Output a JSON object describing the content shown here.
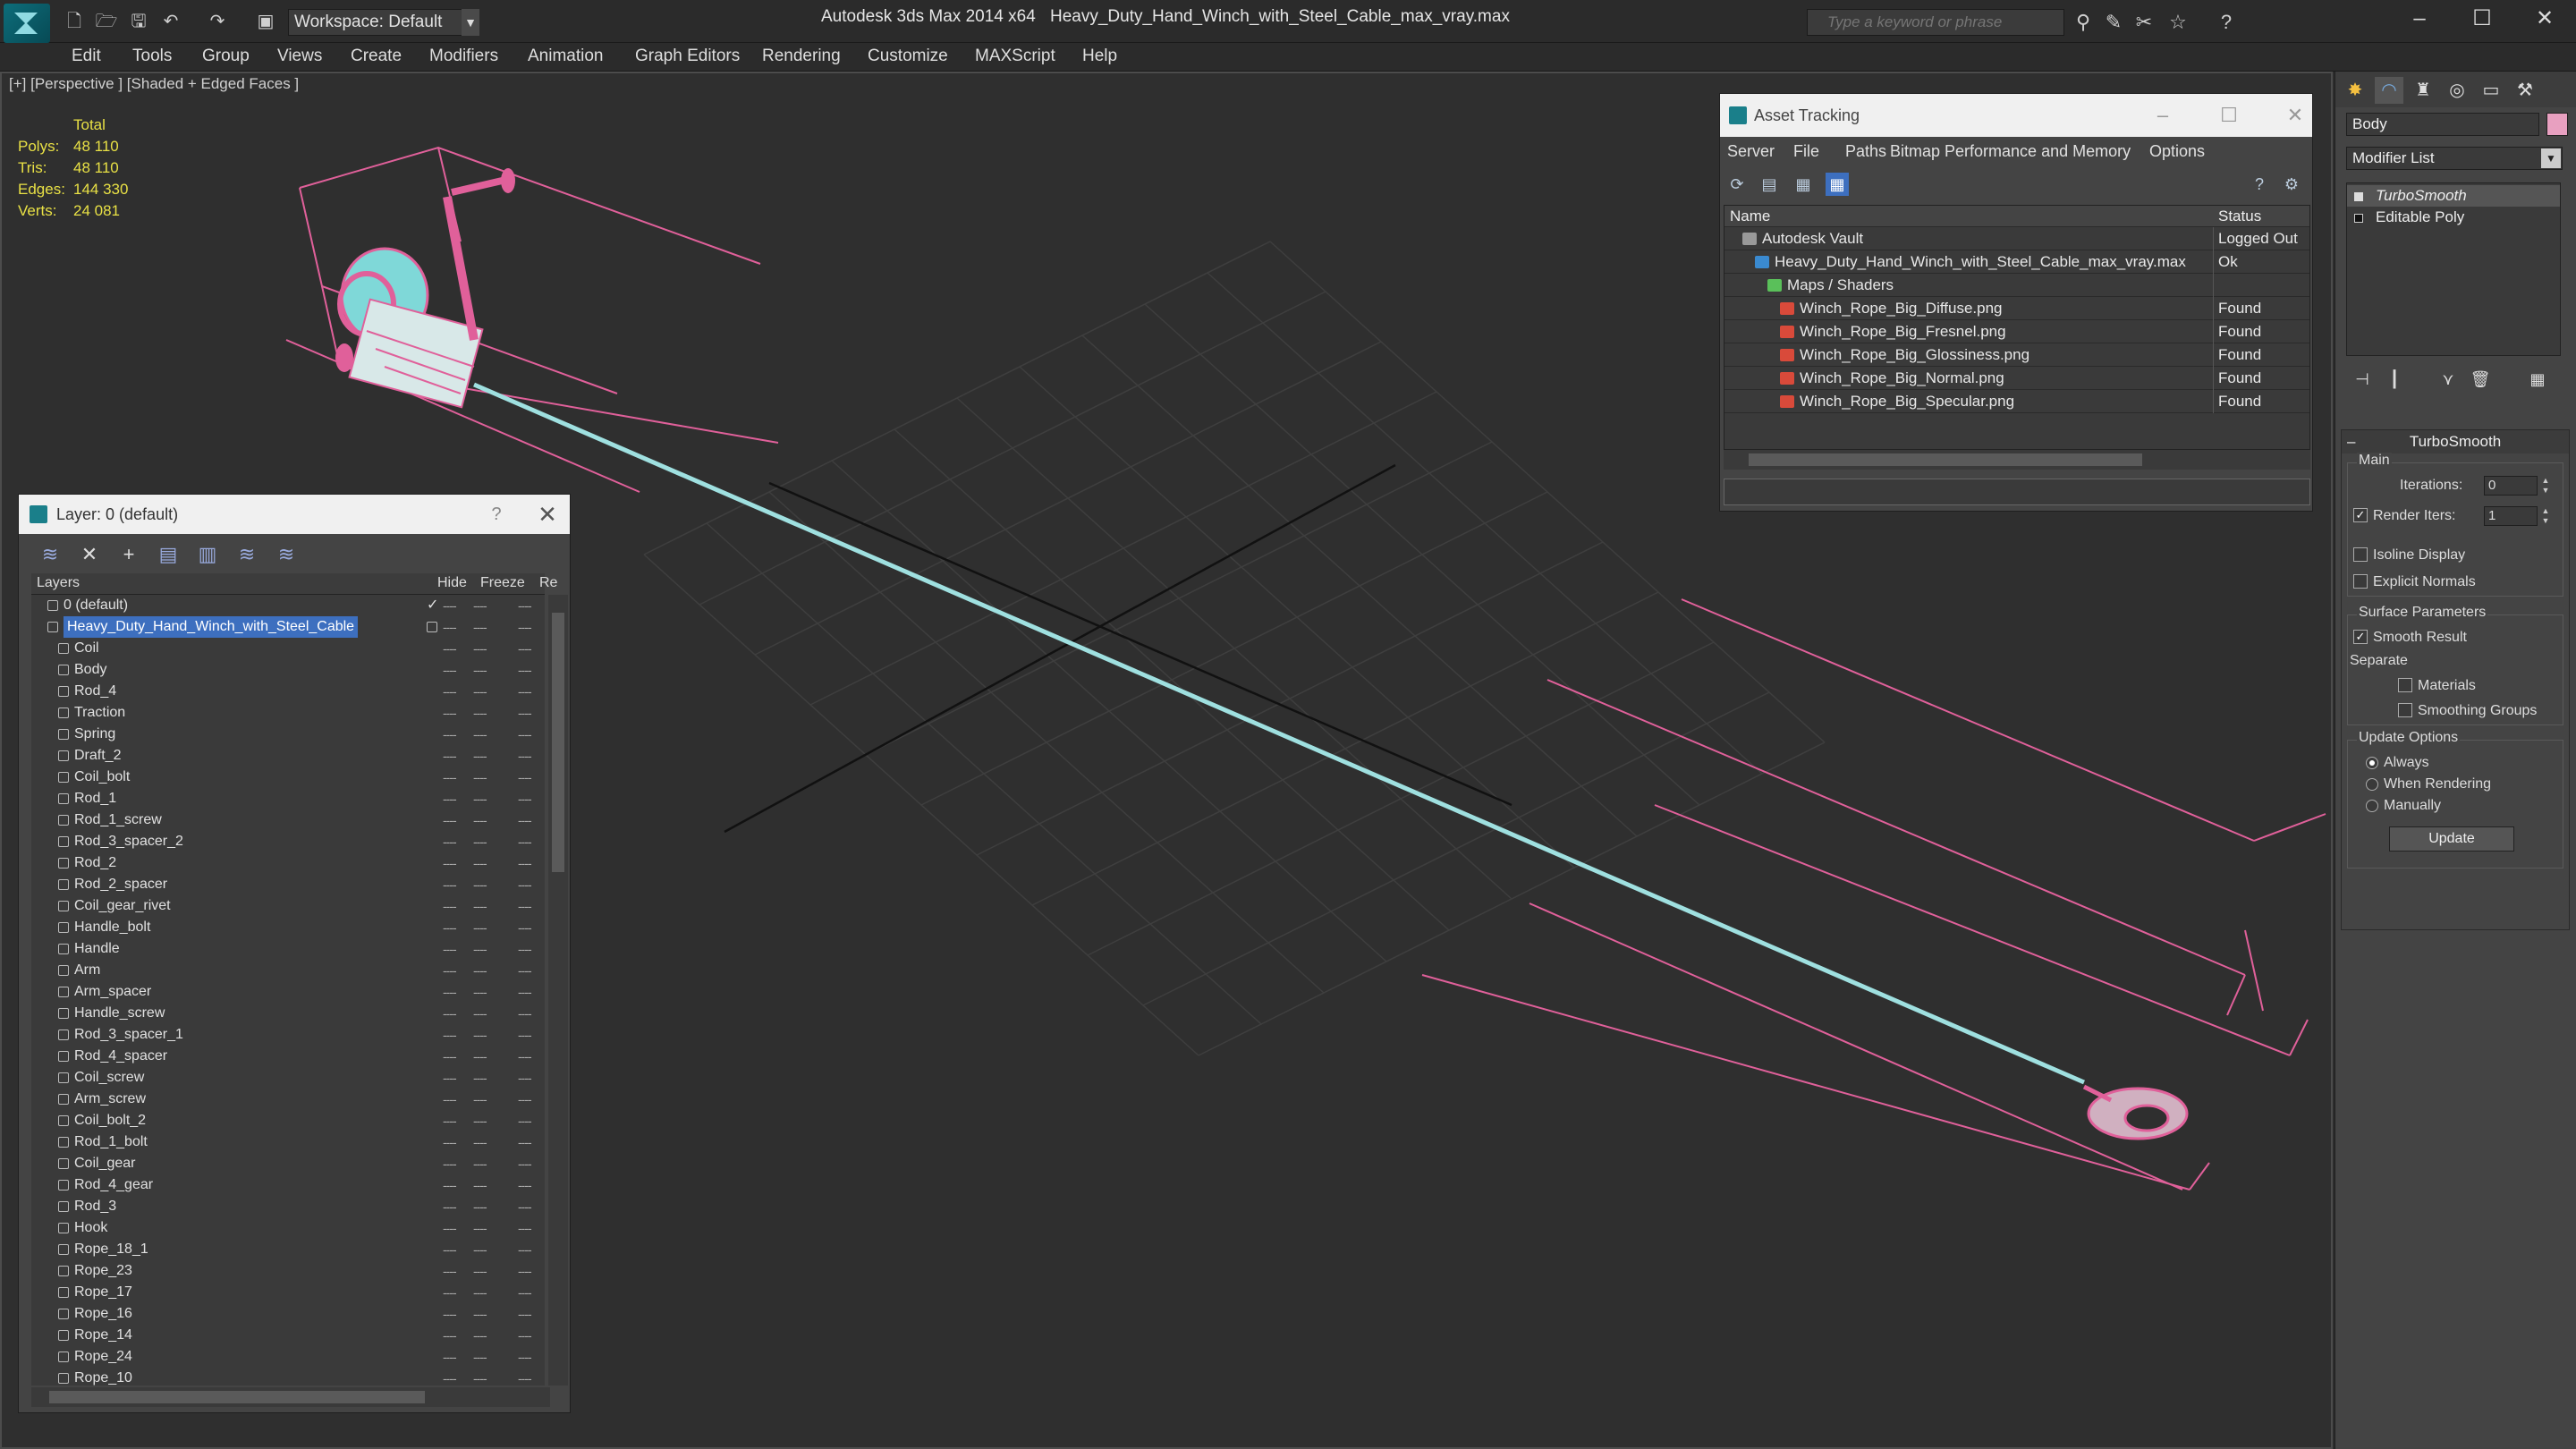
{
  "titlebar": {
    "workspace": "Workspace: Default",
    "app_title": "Autodesk 3ds Max  2014 x64",
    "file_name": "Heavy_Duty_Hand_Winch_with_Steel_Cable_max_vray.max",
    "search_placeholder": "Type a keyword or phrase"
  },
  "menu": [
    "Edit",
    "Tools",
    "Group",
    "Views",
    "Create",
    "Modifiers",
    "Animation",
    "Graph Editors",
    "Rendering",
    "Customize",
    "MAXScript",
    "Help"
  ],
  "viewport": {
    "label": "[+] [Perspective ] [Shaded + Edged Faces ]",
    "stats": {
      "header": "Total",
      "polys_label": "Polys:",
      "polys": "48 110",
      "tris_label": "Tris:",
      "tris": "48 110",
      "edges_label": "Edges:",
      "edges": "144 330",
      "verts_label": "Verts:",
      "verts": "24 081"
    }
  },
  "layer_panel": {
    "title": "Layer: 0 (default)",
    "help": "?",
    "columns": {
      "layers": "Layers",
      "hide": "Hide",
      "freeze": "Freeze",
      "render": "Re"
    },
    "rows": [
      {
        "name": "0 (default)",
        "level": 0,
        "checked": true
      },
      {
        "name": "Heavy_Duty_Hand_Winch_with_Steel_Cable",
        "level": 0,
        "selected": true
      },
      {
        "name": "Coil",
        "level": 1
      },
      {
        "name": "Body",
        "level": 1
      },
      {
        "name": "Rod_4",
        "level": 1
      },
      {
        "name": "Traction",
        "level": 1
      },
      {
        "name": "Spring",
        "level": 1
      },
      {
        "name": "Draft_2",
        "level": 1
      },
      {
        "name": "Coil_bolt",
        "level": 1
      },
      {
        "name": "Rod_1",
        "level": 1
      },
      {
        "name": "Rod_1_screw",
        "level": 1
      },
      {
        "name": "Rod_3_spacer_2",
        "level": 1
      },
      {
        "name": "Rod_2",
        "level": 1
      },
      {
        "name": "Rod_2_spacer",
        "level": 1
      },
      {
        "name": "Coil_gear_rivet",
        "level": 1
      },
      {
        "name": "Handle_bolt",
        "level": 1
      },
      {
        "name": "Handle",
        "level": 1
      },
      {
        "name": "Arm",
        "level": 1
      },
      {
        "name": "Arm_spacer",
        "level": 1
      },
      {
        "name": "Handle_screw",
        "level": 1
      },
      {
        "name": "Rod_3_spacer_1",
        "level": 1
      },
      {
        "name": "Rod_4_spacer",
        "level": 1
      },
      {
        "name": "Coil_screw",
        "level": 1
      },
      {
        "name": "Arm_screw",
        "level": 1
      },
      {
        "name": "Coil_bolt_2",
        "level": 1
      },
      {
        "name": "Rod_1_bolt",
        "level": 1
      },
      {
        "name": "Coil_gear",
        "level": 1
      },
      {
        "name": "Rod_4_gear",
        "level": 1
      },
      {
        "name": "Rod_3",
        "level": 1
      },
      {
        "name": "Hook",
        "level": 1
      },
      {
        "name": "Rope_18_1",
        "level": 1
      },
      {
        "name": "Rope_23",
        "level": 1
      },
      {
        "name": "Rope_17",
        "level": 1
      },
      {
        "name": "Rope_16",
        "level": 1
      },
      {
        "name": "Rope_14",
        "level": 1
      },
      {
        "name": "Rope_24",
        "level": 1
      },
      {
        "name": "Rope_10",
        "level": 1
      }
    ]
  },
  "asset_tracking": {
    "title": "Asset Tracking",
    "menu": [
      "Server",
      "File",
      "Paths",
      "Bitmap Performance and Memory",
      "Options"
    ],
    "columns": {
      "name": "Name",
      "status": "Status"
    },
    "rows": [
      {
        "name": "Autodesk Vault",
        "status": "Logged Out",
        "level": 0,
        "icon": "vault-icon"
      },
      {
        "name": "Heavy_Duty_Hand_Winch_with_Steel_Cable_max_vray.max",
        "status": "Ok",
        "level": 1,
        "icon": "max-file-icon"
      },
      {
        "name": "Maps / Shaders",
        "status": "",
        "level": 2,
        "icon": "maps-icon"
      },
      {
        "name": "Winch_Rope_Big_Diffuse.png",
        "status": "Found",
        "level": 3,
        "icon": "png-icon"
      },
      {
        "name": "Winch_Rope_Big_Fresnel.png",
        "status": "Found",
        "level": 3,
        "icon": "png-icon"
      },
      {
        "name": "Winch_Rope_Big_Glossiness.png",
        "status": "Found",
        "level": 3,
        "icon": "png-icon"
      },
      {
        "name": "Winch_Rope_Big_Normal.png",
        "status": "Found",
        "level": 3,
        "icon": "png-icon"
      },
      {
        "name": "Winch_Rope_Big_Specular.png",
        "status": "Found",
        "level": 3,
        "icon": "png-icon"
      }
    ]
  },
  "command_panel": {
    "object_name": "Body",
    "object_color": "#e8a0c0",
    "modifier_list": "Modifier List",
    "stack": [
      "TurboSmooth",
      "Editable Poly"
    ],
    "rollout_title": "TurboSmooth",
    "main_label": "Main",
    "iterations_label": "Iterations:",
    "iterations_value": "0",
    "render_iters_label": "Render Iters:",
    "render_iters_value": "1",
    "isoline_label": "Isoline Display",
    "explicit_normals_label": "Explicit Normals",
    "surface_params_label": "Surface Parameters",
    "smooth_result_label": "Smooth Result",
    "separate_label": "Separate",
    "materials_label": "Materials",
    "smoothing_groups_label": "Smoothing Groups",
    "update_options_label": "Update Options",
    "always_label": "Always",
    "when_rendering_label": "When Rendering",
    "manually_label": "Manually",
    "update_button": "Update"
  },
  "colors": {
    "accent": "#1a7f8a",
    "selection": "#3d6fbf",
    "stats_yellow": "#e8e045",
    "wire_pink": "#e0609a",
    "cable": "#9fe0e0"
  }
}
